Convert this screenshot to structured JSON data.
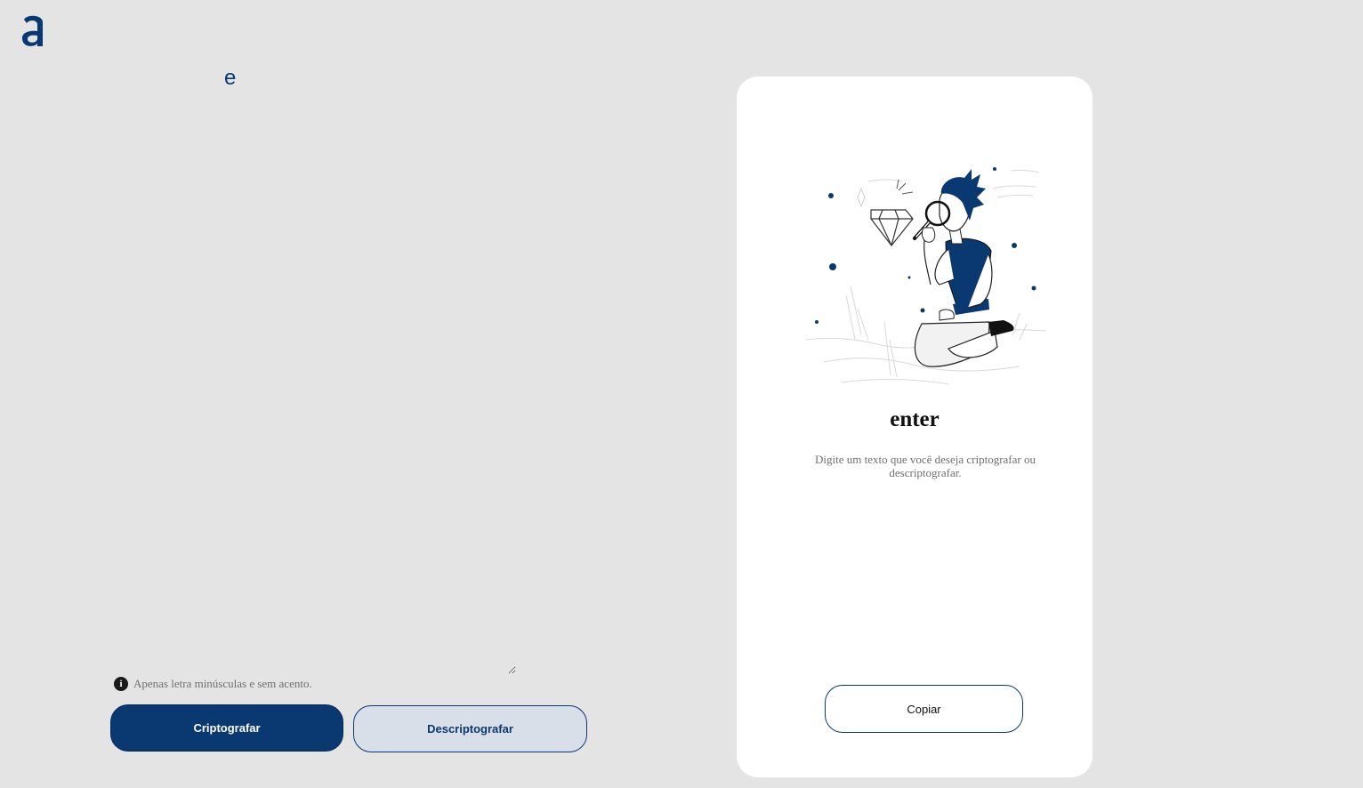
{
  "logo": {
    "icon": "alura-a-logo"
  },
  "input": {
    "value": "e",
    "placeholder": ""
  },
  "info": {
    "icon": "info-icon",
    "icon_glyph": "i",
    "text": "Apenas letra minúsculas e sem acento."
  },
  "buttons": {
    "encrypt_label": "Criptografar",
    "decrypt_label": "Descriptografar"
  },
  "result_panel": {
    "illustration": "person-with-magnifying-glass-illustration",
    "title": "enter",
    "description": "Digite um texto que você deseja criptografar ou descriptografar.",
    "copy_label": "Copiar"
  },
  "colors": {
    "background": "#e4e4e4",
    "accent": "#0a3871",
    "card": "#ffffff",
    "secondary_button": "#d8dfe8"
  }
}
